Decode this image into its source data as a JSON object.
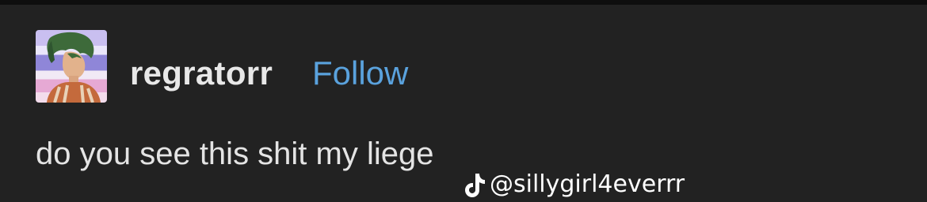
{
  "post": {
    "avatar_icon": "anime-character-avatar",
    "avatar_stripe_colors": [
      "#c9bff0",
      "#eae6fb",
      "#8f86d8",
      "#f1e9f5",
      "#e6a9d4"
    ],
    "username": "regratorr",
    "follow_label": "Follow",
    "follow_color": "#5aa2dd",
    "text": "do you see this shit my liege"
  },
  "watermark": {
    "icon": "tiktok-icon",
    "handle": "@sillygirl4everrr"
  }
}
